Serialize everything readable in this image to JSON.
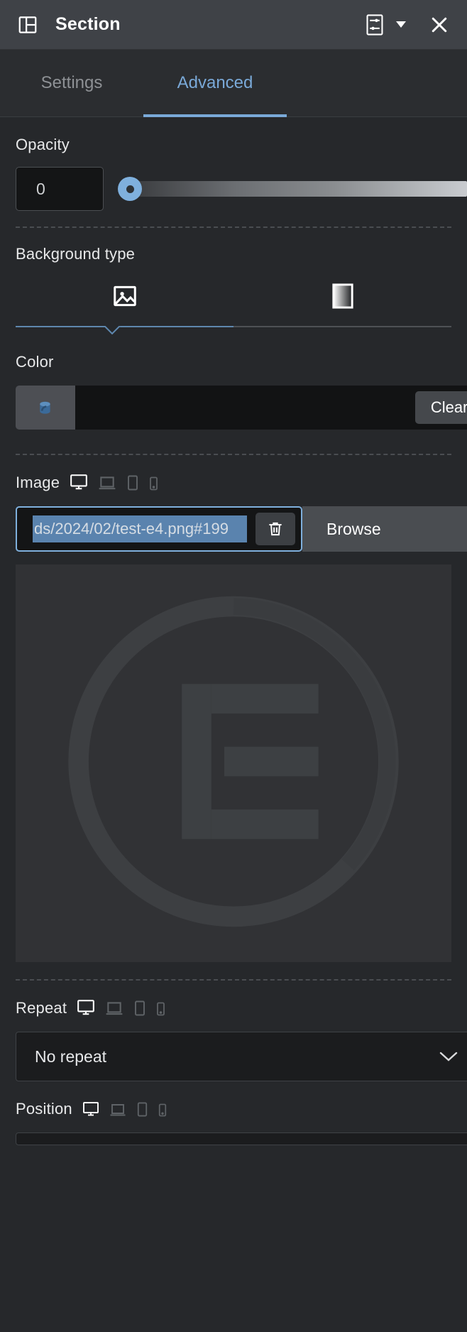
{
  "header": {
    "title": "Section",
    "layout_icon": "section-layout-icon",
    "advanced_icon": "sliders-icon",
    "caret_icon": "caret-down-icon",
    "close_icon": "close-icon",
    "bg": "#3f4247"
  },
  "tabs": [
    {
      "label": "Settings",
      "active": false
    },
    {
      "label": "Advanced",
      "active": true
    }
  ],
  "accent": "#7aa9d8",
  "controls": {
    "opacity": {
      "label": "Opacity",
      "value": "0",
      "slider_percent": 0
    },
    "background_type": {
      "label": "Background type",
      "options": [
        {
          "name": "classic",
          "icon": "image-icon",
          "active": true
        },
        {
          "name": "gradient",
          "icon": "gradient-icon",
          "active": false
        }
      ]
    },
    "color": {
      "label": "Color",
      "swatch_icon": "paint-bucket-icon",
      "value": "",
      "clear_label": "Clear",
      "preview_color": "#121314"
    },
    "image": {
      "label": "Image",
      "devices": [
        {
          "name": "desktop",
          "icon": "desktop-icon",
          "active": true
        },
        {
          "name": "laptop",
          "icon": "laptop-icon",
          "active": false
        },
        {
          "name": "tablet",
          "icon": "tablet-icon",
          "active": false
        },
        {
          "name": "mobile",
          "icon": "mobile-icon",
          "active": false
        }
      ],
      "url_value": "ds/2024/02/test-e4.png#199",
      "url_selected": true,
      "delete_icon": "trash-icon",
      "browse_label": "Browse",
      "preview_alt": "elementor-placeholder-logo"
    },
    "repeat": {
      "label": "Repeat",
      "devices": [
        {
          "name": "desktop",
          "icon": "desktop-icon",
          "active": true
        },
        {
          "name": "laptop",
          "icon": "laptop-icon",
          "active": false
        },
        {
          "name": "tablet",
          "icon": "tablet-icon",
          "active": false
        },
        {
          "name": "mobile",
          "icon": "mobile-icon",
          "active": false
        }
      ],
      "value": "No repeat",
      "chevron_icon": "chevron-down-icon"
    },
    "position": {
      "label": "Position",
      "devices": [
        {
          "name": "desktop",
          "icon": "desktop-icon",
          "active": true
        },
        {
          "name": "laptop",
          "icon": "laptop-icon",
          "active": false
        },
        {
          "name": "tablet",
          "icon": "tablet-icon",
          "active": false
        },
        {
          "name": "mobile",
          "icon": "mobile-icon",
          "active": false
        }
      ]
    }
  }
}
